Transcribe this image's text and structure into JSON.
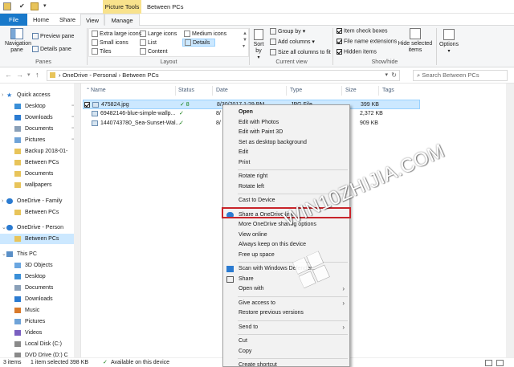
{
  "window": {
    "context_tab_title": "Picture Tools",
    "title": "Between PCs"
  },
  "ribbon_tabs": [
    {
      "label": "File"
    },
    {
      "label": "Home"
    },
    {
      "label": "Share"
    },
    {
      "label": "View"
    },
    {
      "label": "Manage"
    }
  ],
  "ribbon": {
    "panes": {
      "navigation_pane": "Navigation pane",
      "preview_pane": "Preview pane",
      "details_pane": "Details pane",
      "label": "Panes"
    },
    "layout": {
      "items": [
        "Extra large icons",
        "Large icons",
        "Medium icons",
        "Small icons",
        "List",
        "Details",
        "Tiles",
        "Content"
      ],
      "label": "Layout"
    },
    "current_view": {
      "sort_by": "Sort by",
      "group_by": "Group by",
      "add_columns": "Add columns",
      "size_all_columns": "Size all columns to fit",
      "label": "Current view"
    },
    "show_hide": {
      "item_check_boxes": "Item check boxes",
      "file_name_extensions": "File name extensions",
      "hidden_items": "Hidden items",
      "hide_selected": "Hide selected items",
      "label": "Show/hide"
    },
    "options": "Options"
  },
  "address": {
    "path": [
      "OneDrive - Personal",
      "Between PCs"
    ],
    "search_placeholder": "Search Between PCs"
  },
  "nav": {
    "items": [
      {
        "label": "Quick access",
        "icon": "star-icon",
        "pin": ""
      },
      {
        "label": "Desktop",
        "icon": "desktop-icon",
        "pin": "📌"
      },
      {
        "label": "Downloads",
        "icon": "download-icon",
        "pin": "📌"
      },
      {
        "label": "Documents",
        "icon": "document-icon",
        "pin": "📌"
      },
      {
        "label": "Pictures",
        "icon": "pictures-icon",
        "pin": "📌"
      },
      {
        "label": "Backup 2018-01-",
        "icon": "folder-icon",
        "pin": ""
      },
      {
        "label": "Between PCs",
        "icon": "folder-icon",
        "pin": ""
      },
      {
        "label": "Documents",
        "icon": "folder-icon",
        "pin": ""
      },
      {
        "label": "wallpapers",
        "icon": "folder-icon",
        "pin": ""
      },
      {
        "label": "OneDrive - Family",
        "icon": "cloud-icon",
        "pin": ""
      },
      {
        "label": "Between PCs",
        "icon": "folder-icon",
        "pin": ""
      },
      {
        "label": "OneDrive - Person",
        "icon": "cloud-icon",
        "pin": ""
      },
      {
        "label": "Between PCs",
        "icon": "folder-icon",
        "pin": ""
      },
      {
        "label": "This PC",
        "icon": "computer-icon",
        "pin": ""
      },
      {
        "label": "3D Objects",
        "icon": "cube-icon",
        "pin": ""
      },
      {
        "label": "Desktop",
        "icon": "desktop-icon",
        "pin": ""
      },
      {
        "label": "Documents",
        "icon": "document-icon",
        "pin": ""
      },
      {
        "label": "Downloads",
        "icon": "download-icon",
        "pin": ""
      },
      {
        "label": "Music",
        "icon": "music-icon",
        "pin": ""
      },
      {
        "label": "Pictures",
        "icon": "pictures-icon",
        "pin": ""
      },
      {
        "label": "Videos",
        "icon": "video-icon",
        "pin": ""
      },
      {
        "label": "Local Disk (C:)",
        "icon": "disk-icon",
        "pin": ""
      },
      {
        "label": "DVD Drive (D:) C",
        "icon": "dvd-icon",
        "pin": ""
      }
    ]
  },
  "files": {
    "columns": [
      "Name",
      "Status",
      "Date",
      "Type",
      "Size",
      "Tags"
    ],
    "rows": [
      {
        "name": "475824.jpg",
        "status": "✓ 8",
        "date": "8/30/2017 1:29 PM",
        "type": "JPG File",
        "size": "399 KB"
      },
      {
        "name": "69482146-blue-simple-wallp...",
        "status": "✓",
        "date": "8/",
        "type": "",
        "size": "2,372 KB"
      },
      {
        "name": "1440743780_Sea-Sunset-Wal...",
        "status": "✓",
        "date": "8/",
        "type": "",
        "size": "909 KB"
      }
    ]
  },
  "context_menu": {
    "items": [
      {
        "label": "Open",
        "bold": true,
        "submenu": false,
        "icon": ""
      },
      {
        "label": "Edit with Photos",
        "submenu": false,
        "icon": ""
      },
      {
        "label": "Edit with Paint 3D",
        "submenu": false,
        "icon": ""
      },
      {
        "label": "Set as desktop background",
        "submenu": false,
        "icon": ""
      },
      {
        "label": "Edit",
        "submenu": false,
        "icon": ""
      },
      {
        "label": "Print",
        "submenu": false,
        "icon": ""
      },
      {
        "sep": true
      },
      {
        "label": "Rotate right",
        "submenu": false,
        "icon": ""
      },
      {
        "label": "Rotate left",
        "submenu": false,
        "icon": ""
      },
      {
        "sep": true
      },
      {
        "label": "Cast to Device",
        "submenu": true,
        "icon": ""
      },
      {
        "sep": true
      },
      {
        "label": "Share a OneDrive link",
        "submenu": false,
        "icon": "cloud-icon"
      },
      {
        "label": "More OneDrive sharing options",
        "submenu": false,
        "icon": ""
      },
      {
        "label": "View online",
        "submenu": false,
        "icon": ""
      },
      {
        "label": "Always keep on this device",
        "submenu": false,
        "icon": ""
      },
      {
        "label": "Free up space",
        "submenu": false,
        "icon": ""
      },
      {
        "sep": true
      },
      {
        "label": "Scan with Windows Defender...",
        "submenu": false,
        "icon": "defender-icon"
      },
      {
        "label": "Share",
        "submenu": false,
        "icon": "share-icon"
      },
      {
        "label": "Open with",
        "submenu": true,
        "icon": ""
      },
      {
        "sep": true
      },
      {
        "label": "Give access to",
        "submenu": true,
        "icon": ""
      },
      {
        "label": "Restore previous versions",
        "submenu": false,
        "icon": ""
      },
      {
        "sep": true
      },
      {
        "label": "Send to",
        "submenu": true,
        "icon": ""
      },
      {
        "sep": true
      },
      {
        "label": "Cut",
        "submenu": false,
        "icon": ""
      },
      {
        "label": "Copy",
        "submenu": false,
        "icon": ""
      },
      {
        "sep": true
      },
      {
        "label": "Create shortcut",
        "submenu": false,
        "icon": ""
      }
    ]
  },
  "status": {
    "items_count": "3 items",
    "selected": "1 item selected  398 KB",
    "availability": "Available on this device"
  },
  "watermark": {
    "text": "WIN10ZHIJIA.COM"
  },
  "colors": {
    "file_tab": "#1979ca",
    "context_tab": "#f8e28c",
    "selection": "#cce8ff",
    "highlight_border": "#c8242a"
  }
}
